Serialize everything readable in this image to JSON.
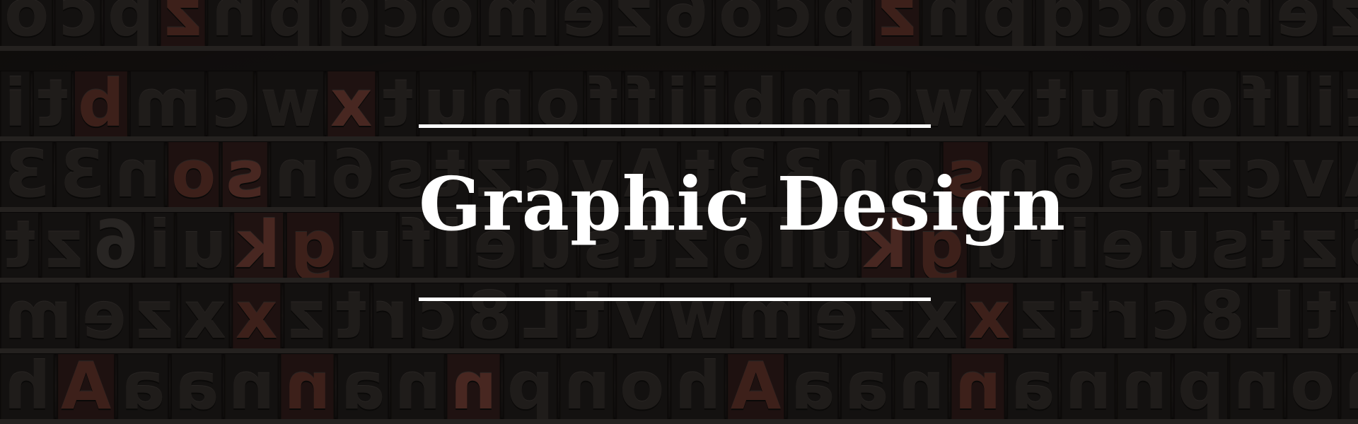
{
  "banner": {
    "title": "Graphic Design"
  },
  "background": {
    "image": "letterpress-wood-type-texture",
    "colors": {
      "base": "#1b1816",
      "glyph": "#2b2826",
      "glyph_red": "#5a2e26",
      "rule": "#ffffff",
      "title": "#ffffff"
    }
  }
}
